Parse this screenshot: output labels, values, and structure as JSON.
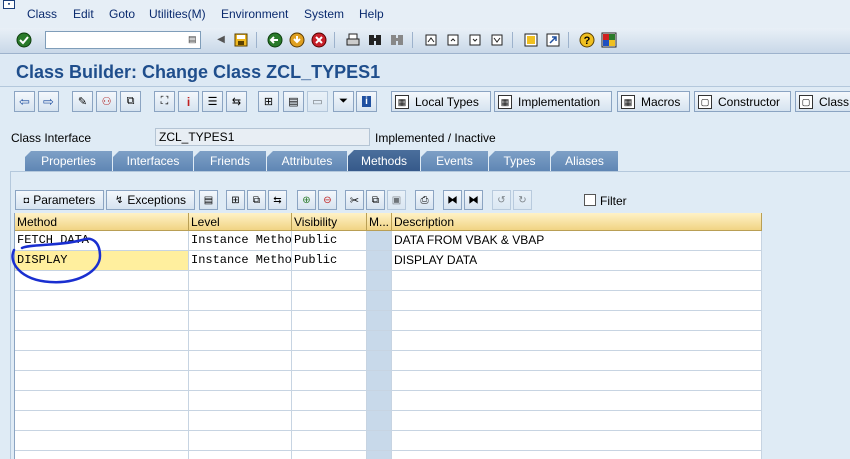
{
  "menu": [
    "Class",
    "Edit",
    "Goto",
    "Utilities(M)",
    "Environment",
    "System",
    "Help"
  ],
  "title": "Class Builder: Change Class ZCL_TYPES1",
  "app_toolbar": {
    "local_types": "Local Types",
    "implementation": "Implementation",
    "macros": "Macros",
    "constructor": "Constructor",
    "class_constructor": "Class constructor"
  },
  "class_interface": {
    "label": "Class Interface",
    "value": "ZCL_TYPES1",
    "status": "Implemented / Inactive"
  },
  "tabs": [
    "Properties",
    "Interfaces",
    "Friends",
    "Attributes",
    "Methods",
    "Events",
    "Types",
    "Aliases"
  ],
  "active_tab": "Methods",
  "grid_toolbar": {
    "parameters": "Parameters",
    "exceptions": "Exceptions",
    "filter": "Filter"
  },
  "grid": {
    "headers": [
      "Method",
      "Level",
      "Visibility",
      "M...",
      "Description"
    ],
    "rows": [
      [
        "FETCH_DATA",
        "Instance Method",
        "Public",
        "",
        "DATA FROM VBAK & VBAP"
      ],
      [
        "DISPLAY",
        "Instance Method",
        "Public",
        "",
        "DISPLAY DATA"
      ]
    ]
  },
  "colors": {
    "title": "#1f4e8c",
    "tab_active": "#36598a",
    "tab": "#6a8fbc",
    "grid_header": "#f1d484",
    "selected_cell": "#ffef9e",
    "annotation": "#1a2fd0"
  },
  "icons": [
    "enter-icon",
    "save-icon",
    "back-icon",
    "exit-icon",
    "cancel-icon",
    "print-icon",
    "find-icon",
    "help-icon",
    "layout-icon"
  ]
}
